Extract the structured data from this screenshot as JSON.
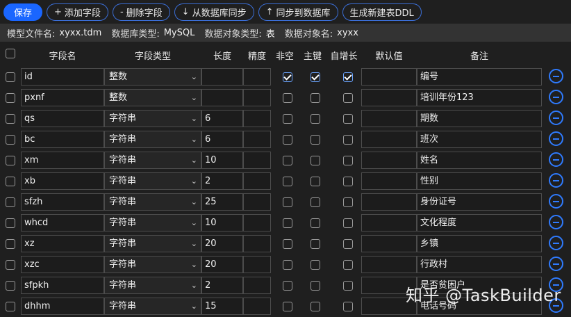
{
  "toolbar": {
    "save": "保存",
    "add_field": "添加字段",
    "delete_field": "删除字段",
    "sync_from_db": "从数据库同步",
    "sync_to_db": "同步到数据库",
    "generate_ddl": "生成新建表DDL"
  },
  "info": {
    "model_file_label": "模型文件名:",
    "model_file": "xyxx.tdm",
    "db_type_label": "数据库类型:",
    "db_type": "MySQL",
    "obj_type_label": "数据对象类型:",
    "obj_type": "表",
    "obj_name_label": "数据对象名:",
    "obj_name": "xyxx"
  },
  "columns": {
    "name": "字段名",
    "type": "字段类型",
    "length": "长度",
    "precision": "精度",
    "not_null": "非空",
    "primary_key": "主键",
    "auto_inc": "自增长",
    "default": "默认值",
    "remark": "备注"
  },
  "rows": [
    {
      "name": "id",
      "type": "整数",
      "length": "",
      "precision": "",
      "not_null": true,
      "pk": true,
      "auto": true,
      "default": "",
      "remark": "编号"
    },
    {
      "name": "pxnf",
      "type": "整数",
      "length": "",
      "precision": "",
      "not_null": false,
      "pk": false,
      "auto": false,
      "default": "",
      "remark": "培训年份123"
    },
    {
      "name": "qs",
      "type": "字符串",
      "length": "6",
      "precision": "",
      "not_null": false,
      "pk": false,
      "auto": false,
      "default": "",
      "remark": "期数"
    },
    {
      "name": "bc",
      "type": "字符串",
      "length": "6",
      "precision": "",
      "not_null": false,
      "pk": false,
      "auto": false,
      "default": "",
      "remark": "班次"
    },
    {
      "name": "xm",
      "type": "字符串",
      "length": "10",
      "precision": "",
      "not_null": false,
      "pk": false,
      "auto": false,
      "default": "",
      "remark": "姓名"
    },
    {
      "name": "xb",
      "type": "字符串",
      "length": "2",
      "precision": "",
      "not_null": false,
      "pk": false,
      "auto": false,
      "default": "",
      "remark": "性别"
    },
    {
      "name": "sfzh",
      "type": "字符串",
      "length": "25",
      "precision": "",
      "not_null": false,
      "pk": false,
      "auto": false,
      "default": "",
      "remark": "身份证号"
    },
    {
      "name": "whcd",
      "type": "字符串",
      "length": "10",
      "precision": "",
      "not_null": false,
      "pk": false,
      "auto": false,
      "default": "",
      "remark": "文化程度"
    },
    {
      "name": "xz",
      "type": "字符串",
      "length": "20",
      "precision": "",
      "not_null": false,
      "pk": false,
      "auto": false,
      "default": "",
      "remark": "乡镇"
    },
    {
      "name": "xzc",
      "type": "字符串",
      "length": "20",
      "precision": "",
      "not_null": false,
      "pk": false,
      "auto": false,
      "default": "",
      "remark": "行政村"
    },
    {
      "name": "sfpkh",
      "type": "字符串",
      "length": "2",
      "precision": "",
      "not_null": false,
      "pk": false,
      "auto": false,
      "default": "",
      "remark": "是否贫困户"
    },
    {
      "name": "dhhm",
      "type": "字符串",
      "length": "15",
      "precision": "",
      "not_null": false,
      "pk": false,
      "auto": false,
      "default": "",
      "remark": "电话号码"
    }
  ],
  "watermark": "知乎 @TaskBuilder",
  "icons": {
    "add": "plus-icon",
    "remove": "minus-icon",
    "sync_down": "arrow-down-icon",
    "sync_up": "arrow-up-icon",
    "delete_row": "minus-circle-icon",
    "dropdown": "chevron-down-icon"
  },
  "colors": {
    "accent": "#1a66ff",
    "background": "#1f1f1f",
    "infobar": "#333333"
  }
}
